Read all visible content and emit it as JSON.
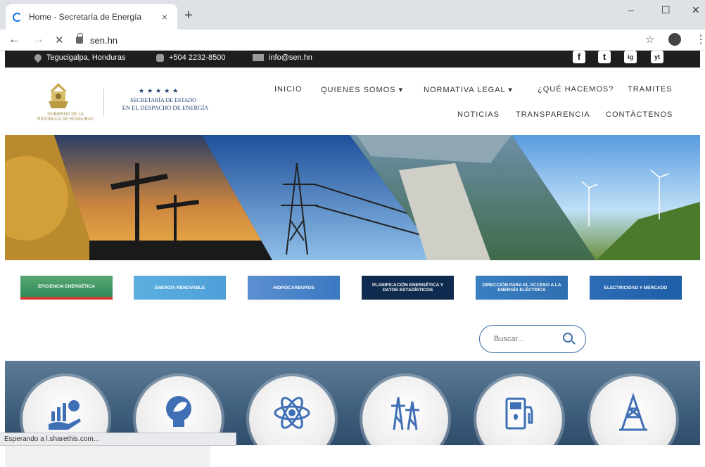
{
  "browser": {
    "tab_title": "Home - Secretaría de Energía",
    "new_tab": "+",
    "close_tab": "×",
    "minimize": "–",
    "maximize": "☐",
    "close_window": "✕",
    "url": "sen.hn",
    "back": "←",
    "forward": "→",
    "stop": "✕",
    "star": "☆",
    "menu": "⋮"
  },
  "topbar": {
    "location": "Tegucigalpa, Honduras",
    "phone": "+504 2232-8500",
    "email": "info@sen.hn",
    "social": [
      "f",
      "t",
      "ig",
      "yt"
    ]
  },
  "logo": {
    "gov_line1": "GOBIERNO DE LA",
    "gov_line2": "REPÚBLICA DE HONDURAS",
    "stars": "★★★★★",
    "line1": "SECRETARÍA DE ESTADO",
    "line2": "EN EL DESPACHO DE ENERGÍA"
  },
  "menu": {
    "row1": [
      "INICIO",
      "QUIENES SOMOS ▾",
      "NORMATIVA LEGAL ▾",
      "¿QUÉ HACEMOS?",
      "TRAMITES"
    ],
    "row2": [
      "NOTICIAS",
      "TRANSPARENCIA",
      "CONTÁCTENOS"
    ]
  },
  "categories": [
    {
      "label": "EFICIENCIA ENERGÉTICA",
      "color": "#2d8a57"
    },
    {
      "label": "ENERGÍA RENOVABLE",
      "color": "#4f9fd8"
    },
    {
      "label": "HIDROCARBUROS",
      "color": "#3b79c2"
    },
    {
      "label": "PLANIFICACIÓN ENERGÉTICA Y DATOS ESTADÍSTICOS",
      "color": "#0f2a4f"
    },
    {
      "label": "DIRECCIÓN PARA EL ACCESO A LA ENERGÍA ELÉCTRICA",
      "color": "#2f6fb0"
    },
    {
      "label": "ELECTRICIDAD Y MERCADO",
      "color": "#1f5fa8"
    }
  ],
  "search": {
    "placeholder": "Buscar..."
  },
  "services": [
    {
      "icon": "efficiency-icon"
    },
    {
      "icon": "lightbulb-leaf-icon"
    },
    {
      "icon": "atom-icon"
    },
    {
      "icon": "power-tower-icon"
    },
    {
      "icon": "fuel-pump-icon"
    },
    {
      "icon": "oil-rig-icon"
    }
  ],
  "status_bar": "Esperando a l.sharethis.com..."
}
